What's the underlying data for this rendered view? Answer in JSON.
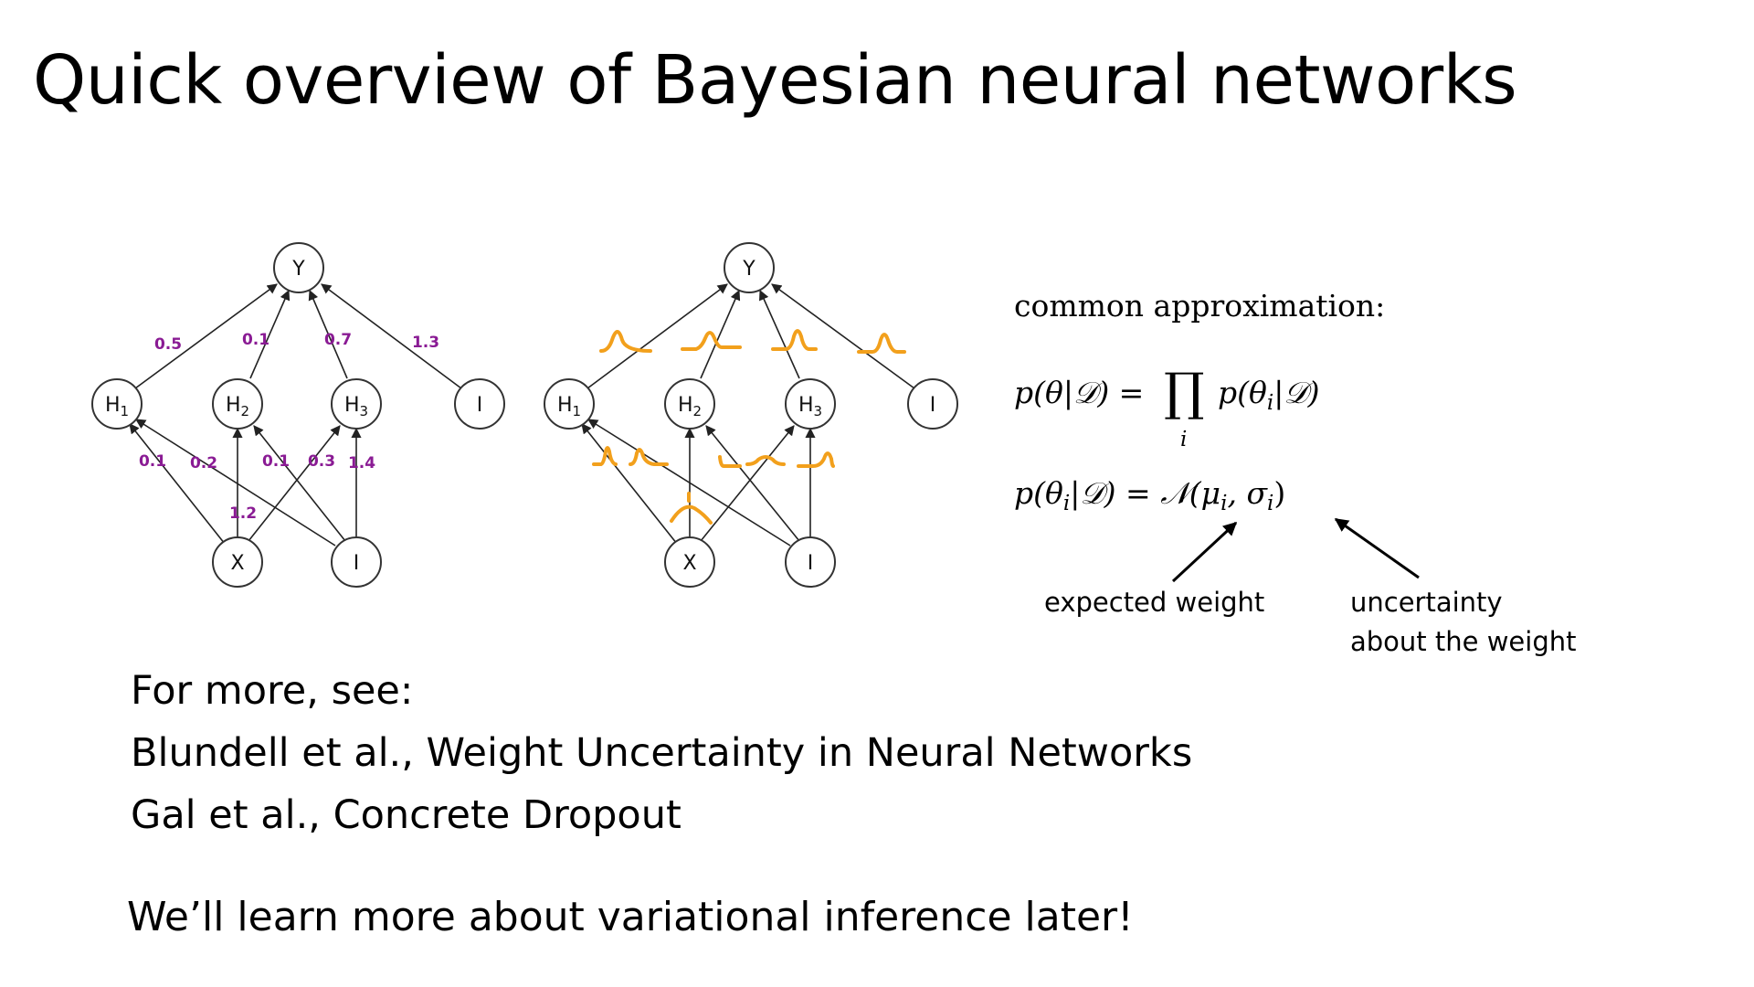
{
  "slide": {
    "title": "Quick overview of Bayesian neural networks"
  },
  "network_standard": {
    "nodes": [
      {
        "id": "Y",
        "text": "Y",
        "sub": ""
      },
      {
        "id": "H1",
        "text": "H",
        "sub": "1"
      },
      {
        "id": "H2",
        "text": "H",
        "sub": "2"
      },
      {
        "id": "H3",
        "text": "H",
        "sub": "3"
      },
      {
        "id": "B1",
        "text": "I",
        "sub": ""
      },
      {
        "id": "X",
        "text": "X",
        "sub": ""
      },
      {
        "id": "B2",
        "text": "I",
        "sub": ""
      }
    ],
    "weight_labels": [
      "0.5",
      "0.1",
      "0.7",
      "1.3",
      "0.1",
      "0.2",
      "0.1",
      "0.3",
      "1.4",
      "1.2"
    ]
  },
  "network_bayesian": {
    "nodes": [
      {
        "id": "Y",
        "text": "Y",
        "sub": ""
      },
      {
        "id": "H1",
        "text": "H",
        "sub": "1"
      },
      {
        "id": "H2",
        "text": "H",
        "sub": "2"
      },
      {
        "id": "H3",
        "text": "H",
        "sub": "3"
      },
      {
        "id": "B1",
        "text": "I",
        "sub": ""
      },
      {
        "id": "X",
        "text": "X",
        "sub": ""
      },
      {
        "id": "B2",
        "text": "I",
        "sub": ""
      }
    ],
    "distribution_color": "#f2a01c"
  },
  "approximation": {
    "heading": "common approximation:",
    "eq1": {
      "lhs": "p(θ|𝒟) = ",
      "prod": "∏",
      "index": "i",
      "rhs": "p(θ",
      "rhs_sub": "i",
      "rhs_end": "|𝒟)"
    },
    "eq2": {
      "lhs": "p(θ",
      "lhs_sub": "i",
      "lhs_end": "|𝒟) = 𝒩(μ",
      "mu_sub": "i",
      "mid": ", σ",
      "sigma_sub": "i",
      "end": ")"
    },
    "note_mean": "expected weight",
    "note_std_line1": "uncertainty",
    "note_std_line2": "about the weight"
  },
  "references": {
    "intro": "For more, see:",
    "items": [
      "Blundell et al., Weight Uncertainty in Neural Networks",
      "Gal et al., Concrete Dropout"
    ]
  },
  "closing": "We’ll learn more about variational inference later!"
}
